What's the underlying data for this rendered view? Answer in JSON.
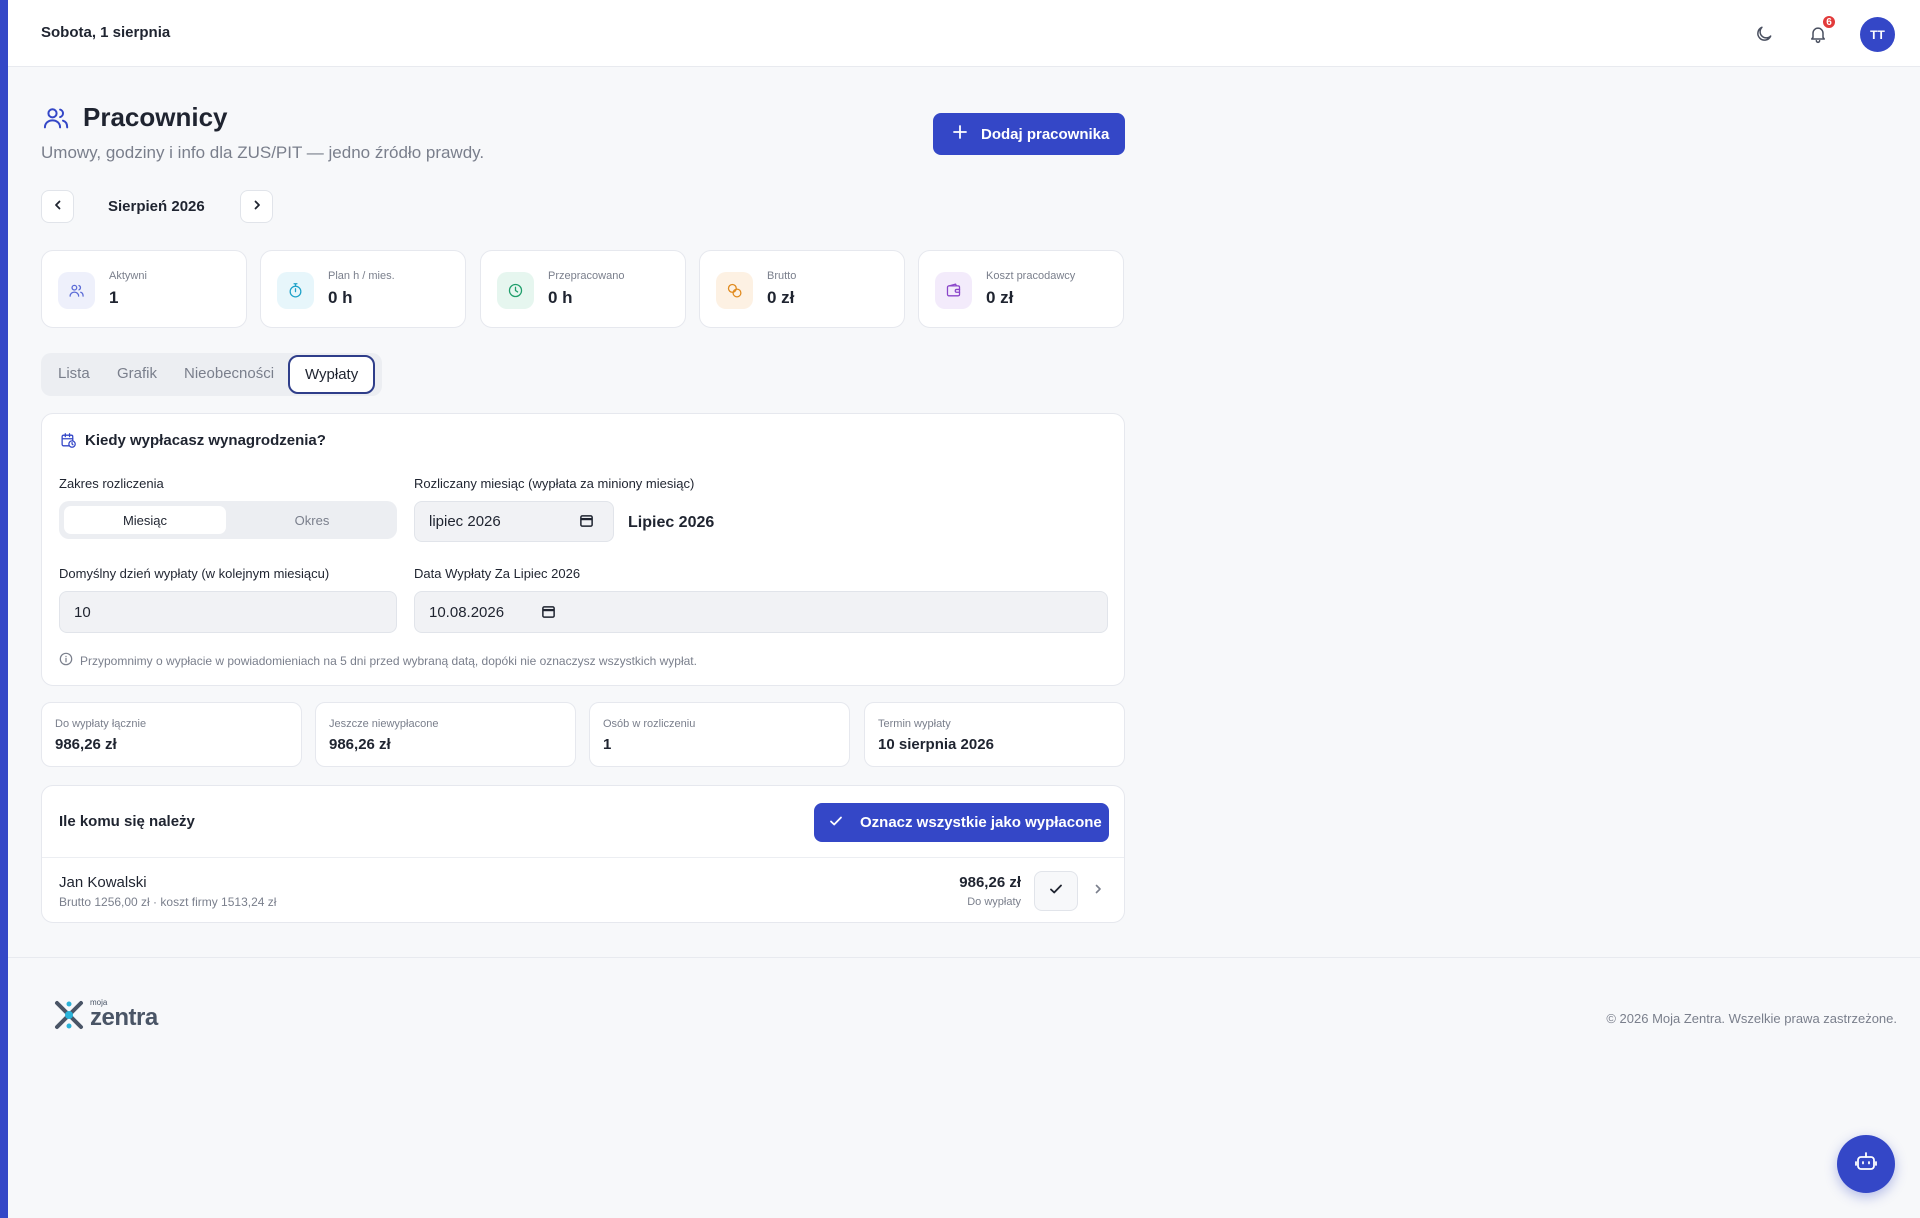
{
  "header": {
    "date": "Sobota, 1 sierpnia",
    "notifications_count": "6",
    "avatar_initials": "TT"
  },
  "page": {
    "title": "Pracownicy",
    "subtitle": "Umowy, godziny i info dla ZUS/PIT — jedno źródło prawdy.",
    "add_button": "Dodaj pracownika",
    "month": "Sierpień 2026"
  },
  "stats": [
    {
      "label": "Aktywni",
      "value": "1",
      "icon": "users-icon",
      "color": "#5b6bd6"
    },
    {
      "label": "Plan h / mies.",
      "value": "0 h",
      "icon": "stopwatch-icon",
      "color": "#1fa2c9"
    },
    {
      "label": "Przepracowano",
      "value": "0 h",
      "icon": "clock-icon",
      "color": "#1f9e6b"
    },
    {
      "label": "Brutto",
      "value": "0 zł",
      "icon": "coins-icon",
      "color": "#e08a1e"
    },
    {
      "label": "Koszt pracodawcy",
      "value": "0 zł",
      "icon": "wallet-icon",
      "color": "#8a45c9"
    }
  ],
  "tabs": [
    "Lista",
    "Grafik",
    "Nieobecności",
    "Wypłaty"
  ],
  "active_tab": "Wypłaty",
  "settings": {
    "title": "Kiedy wypłacasz wynagrodzenia?",
    "range_label": "Zakres rozliczenia",
    "range_options": [
      "Miesiąc",
      "Okres"
    ],
    "range_selected": "Miesiąc",
    "month_label": "Rozliczany miesiąc (wypłata za miniony miesiąc)",
    "month_value": "lipiec 2026",
    "month_display": "Lipiec 2026",
    "default_day_label": "Domyślny dzień wypłaty (w kolejnym miesiącu)",
    "default_day_value": "10",
    "pay_date_label": "Data Wypłaty Za Lipiec 2026",
    "pay_date_value": "10.08.2026",
    "note": "Przypomnimy o wypłacie w powiadomieniach na 5 dni przed wybraną datą, dopóki nie oznaczysz wszystkich wypłat."
  },
  "summary": [
    {
      "label": "Do wypłaty łącznie",
      "value": "986,26 zł"
    },
    {
      "label": "Jeszcze niewypłacone",
      "value": "986,26 zł"
    },
    {
      "label": "Osób w rozliczeniu",
      "value": "1"
    },
    {
      "label": "Termin wypłaty",
      "value": "10 sierpnia 2026"
    }
  ],
  "payouts": {
    "title": "Ile komu się należy",
    "mark_all": "Oznacz wszystkie jako wypłacone",
    "rows": [
      {
        "name": "Jan Kowalski",
        "details": "Brutto 1256,00 zł · koszt firmy 1513,24 zł",
        "amount": "986,26 zł",
        "amount_label": "Do wypłaty"
      }
    ]
  },
  "footer": {
    "logo_prefix": "moja",
    "logo_word": "zentra",
    "copyright": "© 2026 Moja Zentra. Wszelkie prawa zastrzeżone."
  },
  "colors": {
    "accent": "#3447c7",
    "badge": "#e23b3b"
  }
}
